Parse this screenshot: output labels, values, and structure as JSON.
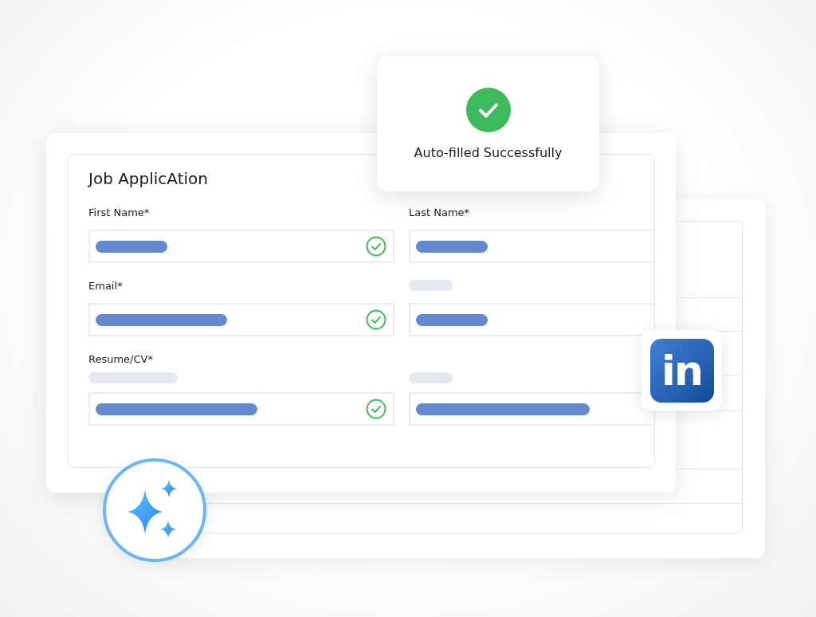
{
  "toast": {
    "message": "Auto-filled Successfully",
    "success": true
  },
  "form": {
    "title": "Job ApplicAtion",
    "rows": [
      {
        "cells": [
          {
            "label": "First Name*",
            "verified": true
          },
          {
            "label": "Last Name*"
          }
        ]
      },
      {
        "cells": [
          {
            "label": "Email*",
            "verified": true
          },
          {
            "skeleton_label": true
          }
        ]
      },
      {
        "cells": [
          {
            "label": "Resume/CV*",
            "skeleton_hint": true,
            "verified": true
          },
          {
            "skeleton_hint": true
          }
        ]
      }
    ]
  },
  "logo_tile": {
    "text": "in"
  }
}
